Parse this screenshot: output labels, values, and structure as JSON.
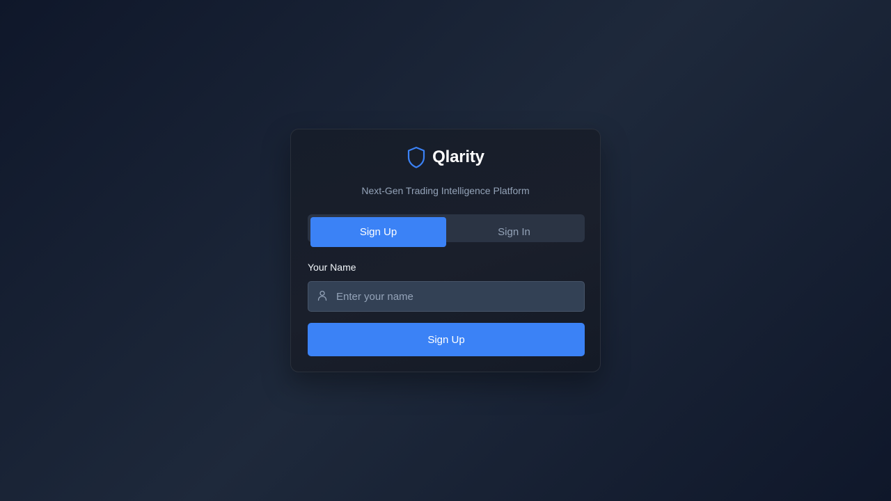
{
  "brand": {
    "name": "Qlarity",
    "icon": "shield-icon",
    "tagline": "Next-Gen Trading Intelligence Platform"
  },
  "tabs": [
    {
      "label": "Sign Up",
      "active": true
    },
    {
      "label": "Sign In",
      "active": false
    }
  ],
  "form": {
    "name_label": "Your Name",
    "name_placeholder": "Enter your name",
    "name_value": "",
    "name_icon": "user-icon",
    "submit_label": "Sign Up"
  },
  "colors": {
    "accent": "#3b82f6",
    "background": "#0f172a",
    "card": "#1a1f2b",
    "muted_text": "#94a3b8"
  }
}
